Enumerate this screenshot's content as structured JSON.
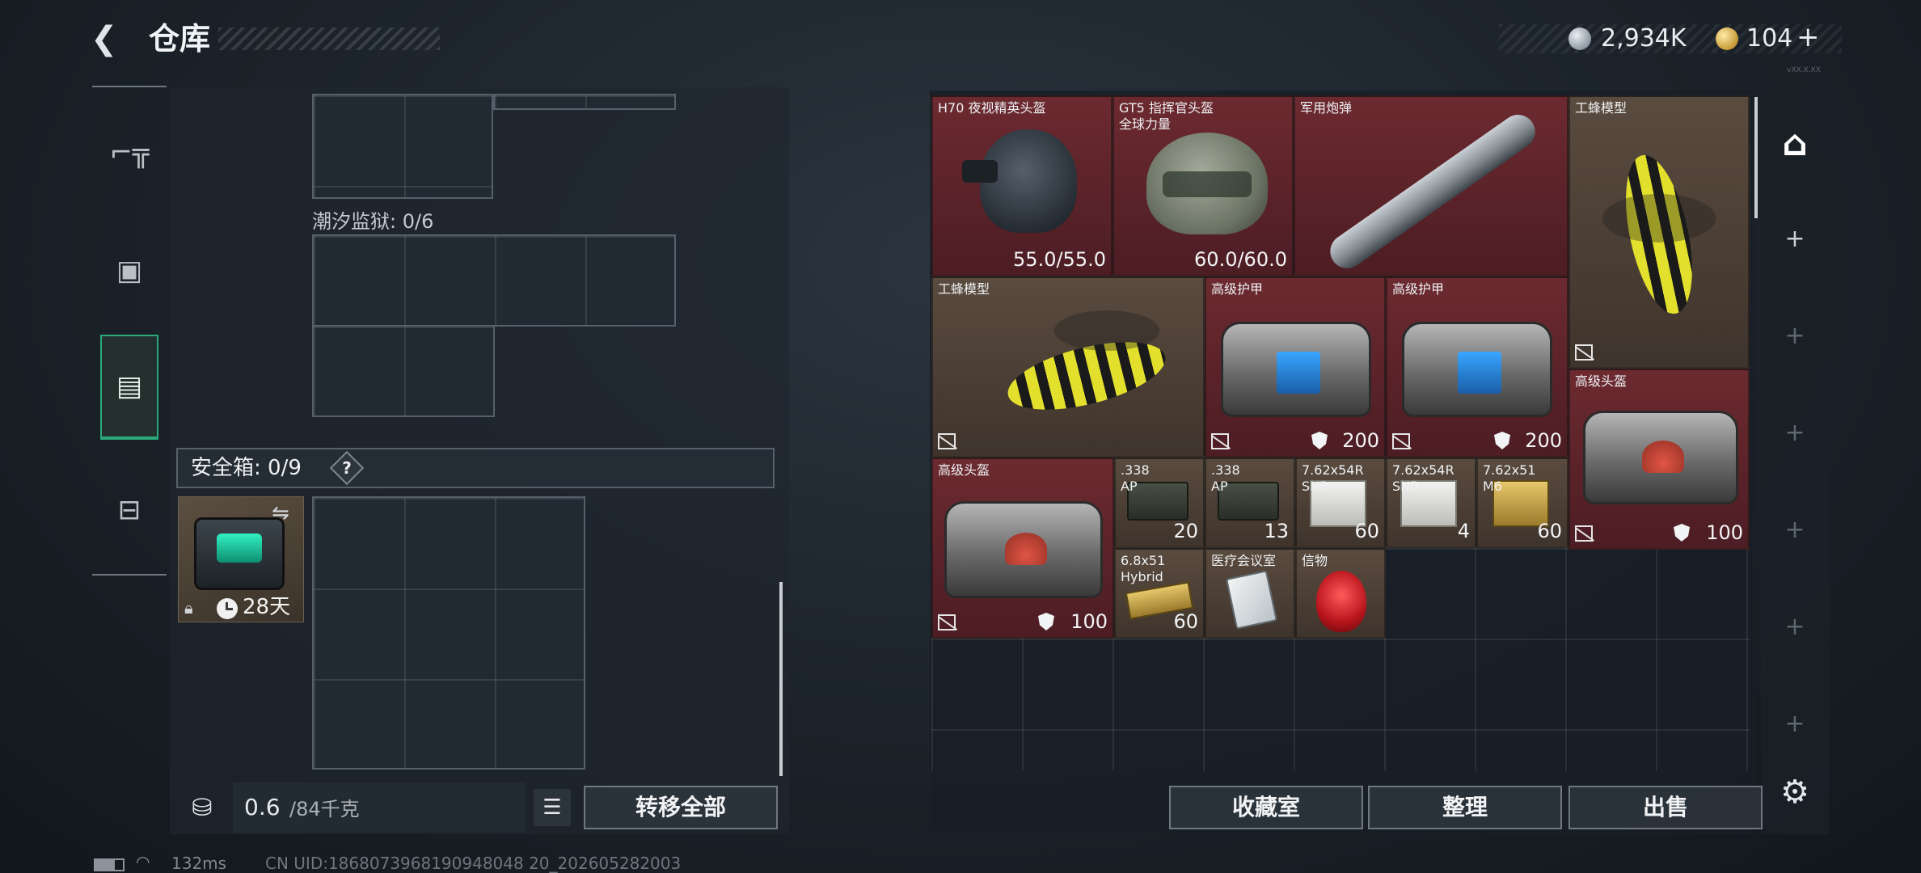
{
  "header": {
    "title": "仓库",
    "back_icon": "chevron-left-icon",
    "currency_silver": "2,934K",
    "currency_gold": "104",
    "plus": "+",
    "version": "vXX.X.XX"
  },
  "tabs": [
    {
      "name": "weapons",
      "icon": "gun-icon"
    },
    {
      "name": "gear",
      "icon": "armor-icon"
    },
    {
      "name": "backpack",
      "icon": "backpack-icon",
      "active": true
    },
    {
      "name": "toolbox",
      "icon": "toolbox-icon"
    }
  ],
  "left": {
    "section_label": "潮汐监狱: 0/6",
    "safe_label": "安全箱: 0/9",
    "help": "?",
    "case_days": "28天",
    "weight_value": "0.6",
    "weight_max": "/84千克",
    "transfer_label": "转移全部"
  },
  "items": {
    "h70": {
      "name": "H70 夜视精英头盔",
      "stat": "55.0/55.0"
    },
    "gt5": {
      "name": "GT5 指挥官头盔\n全球力量",
      "stat": "60.0/60.0"
    },
    "shell": {
      "name": "军用炮弹"
    },
    "bee1": {
      "name": "工蜂模型"
    },
    "bee2": {
      "name": "工蜂模型"
    },
    "armor1": {
      "name": "高级护甲",
      "stat": "200"
    },
    "armor2": {
      "name": "高级护甲",
      "stat": "200"
    },
    "helmet1": {
      "name": "高级头盔",
      "stat": "100"
    },
    "helmet2": {
      "name": "高级头盔",
      "stat": "100"
    },
    "ammo338a": {
      "name": ".338\nAP",
      "count": "20"
    },
    "ammo338b": {
      "name": ".338\nAP",
      "count": "13"
    },
    "ammo762a": {
      "name": "7.62x54R\nSNB",
      "count": "60"
    },
    "ammo762b": {
      "name": "7.62x54R\nSNB",
      "count": "4"
    },
    "ammo76251": {
      "name": "7.62x51\nM6",
      "count": "60"
    },
    "ammo68": {
      "name": "6.8x51\nHybrid",
      "count": "60"
    },
    "medcard": {
      "name": "医疗会议室"
    },
    "letter": {
      "name": "信物"
    }
  },
  "actions": {
    "collect": "收藏室",
    "sort": "整理",
    "sell": "出售"
  },
  "footer": {
    "ping": "132ms",
    "uid": "CN UID:1868073968190948048 20_202605282003"
  },
  "colors": {
    "accent_green": "#2ba97a",
    "rarity_red": "#6c2a30",
    "rarity_brown": "#5a4b3f"
  }
}
